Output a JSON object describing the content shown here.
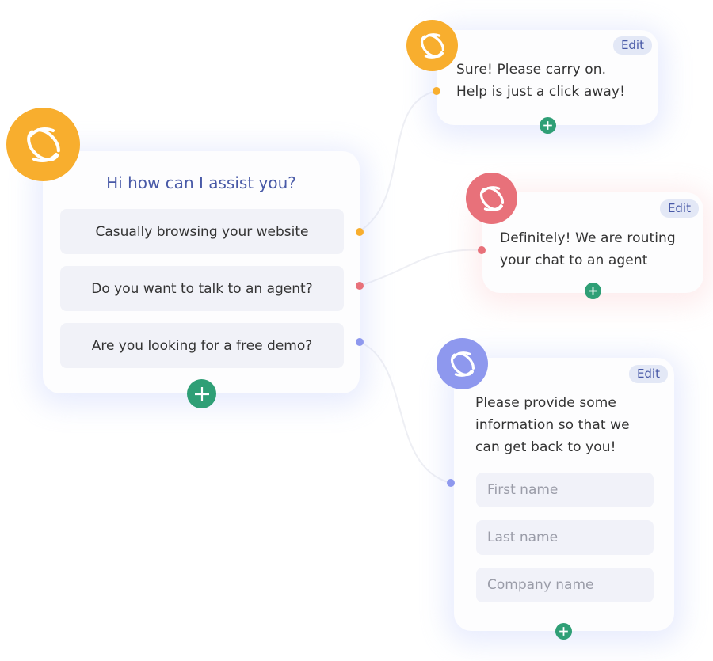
{
  "colors": {
    "orange": "#f8ae2e",
    "red": "#e8717a",
    "purple": "#8e98ee",
    "green": "#2f9f76",
    "title_blue": "#4859a7"
  },
  "main_card": {
    "avatar_icon": "bot-logo-icon",
    "title": "Hi how can I assist you?",
    "options": [
      {
        "label": "Casually browsing your website",
        "connector": "orange"
      },
      {
        "label": "Do you want to talk to an agent?",
        "connector": "red"
      },
      {
        "label": "Are you looking for a free demo?",
        "connector": "purple"
      }
    ],
    "add_icon": "plus-icon"
  },
  "reply_browse": {
    "edit_label": "Edit",
    "lines": [
      "Sure! Please carry on.",
      "Help is just a click away!"
    ]
  },
  "reply_agent": {
    "edit_label": "Edit",
    "lines": [
      "Definitely! We are routing",
      "your chat to an agent"
    ]
  },
  "reply_demo": {
    "edit_label": "Edit",
    "lines": [
      "Please provide some",
      "information so that we",
      "can get back to you!"
    ],
    "fields": [
      {
        "placeholder": "First name"
      },
      {
        "placeholder": "Last name"
      },
      {
        "placeholder": "Company name"
      }
    ]
  }
}
